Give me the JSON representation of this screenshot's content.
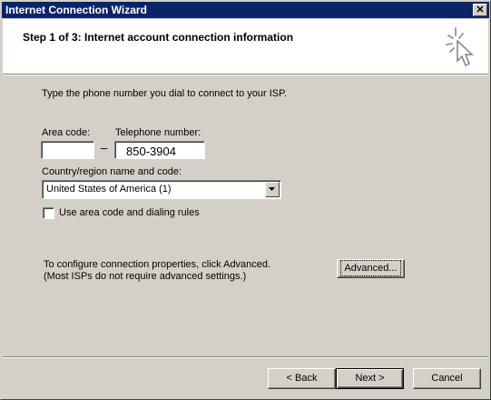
{
  "window": {
    "title": "Internet Connection Wizard",
    "close_glyph": "✕"
  },
  "header": {
    "step_title": "Step 1 of 3: Internet account connection information",
    "icon": "wizard-cursor-icon"
  },
  "form": {
    "instruction": "Type the phone number you dial to connect to your ISP.",
    "area_code_label": "Area code:",
    "area_code_value": "",
    "dash": "–",
    "phone_label": "Telephone number:",
    "phone_value": "850-3904",
    "country_label": "Country/region name and code:",
    "country_value": "United States of America (1)",
    "dialing_rules_label": "Use area code and dialing rules",
    "dialing_rules_checked": false
  },
  "advanced": {
    "line1": "To configure connection properties, click Advanced.",
    "line2": "(Most ISPs do not require advanced settings.)",
    "button_label": "Advanced..."
  },
  "footer": {
    "back_label": "< Back",
    "next_label": "Next >",
    "cancel_label": "Cancel"
  }
}
